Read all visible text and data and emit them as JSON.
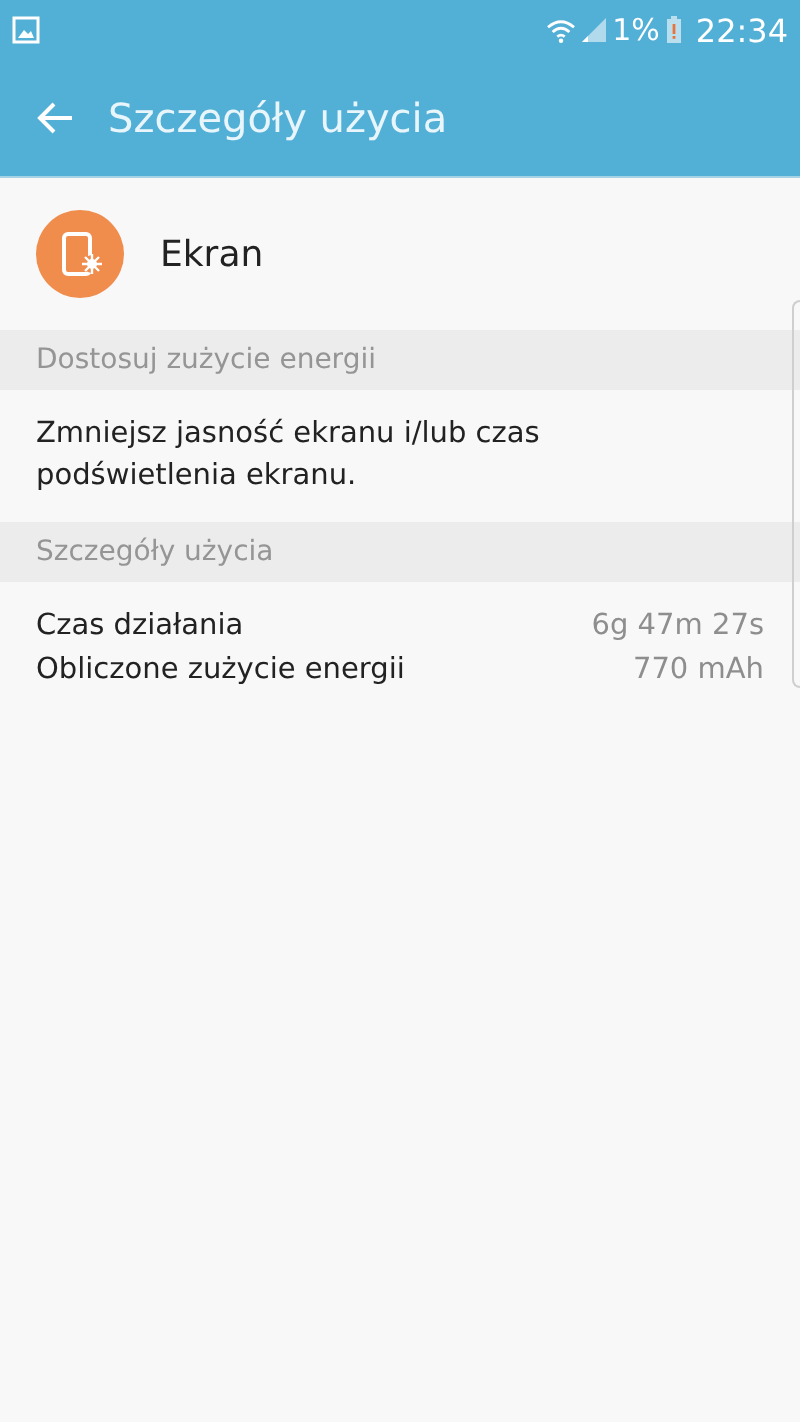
{
  "status_bar": {
    "battery": "1%",
    "time": "22:34"
  },
  "app_bar": {
    "title": "Szczegóły użycia"
  },
  "app": {
    "name": "Ekran"
  },
  "sections": [
    {
      "kind": "text",
      "header": "Dostosuj zużycie energii",
      "text": "Zmniejsz jasność ekranu i/lub czas podświetlenia ekranu."
    },
    {
      "kind": "rows",
      "header": "Szczegóły użycia",
      "rows": [
        {
          "label": "Czas działania",
          "value": "6g 47m 27s"
        },
        {
          "label": "Obliczone zużycie energii",
          "value": "770 mAh"
        }
      ]
    }
  ]
}
